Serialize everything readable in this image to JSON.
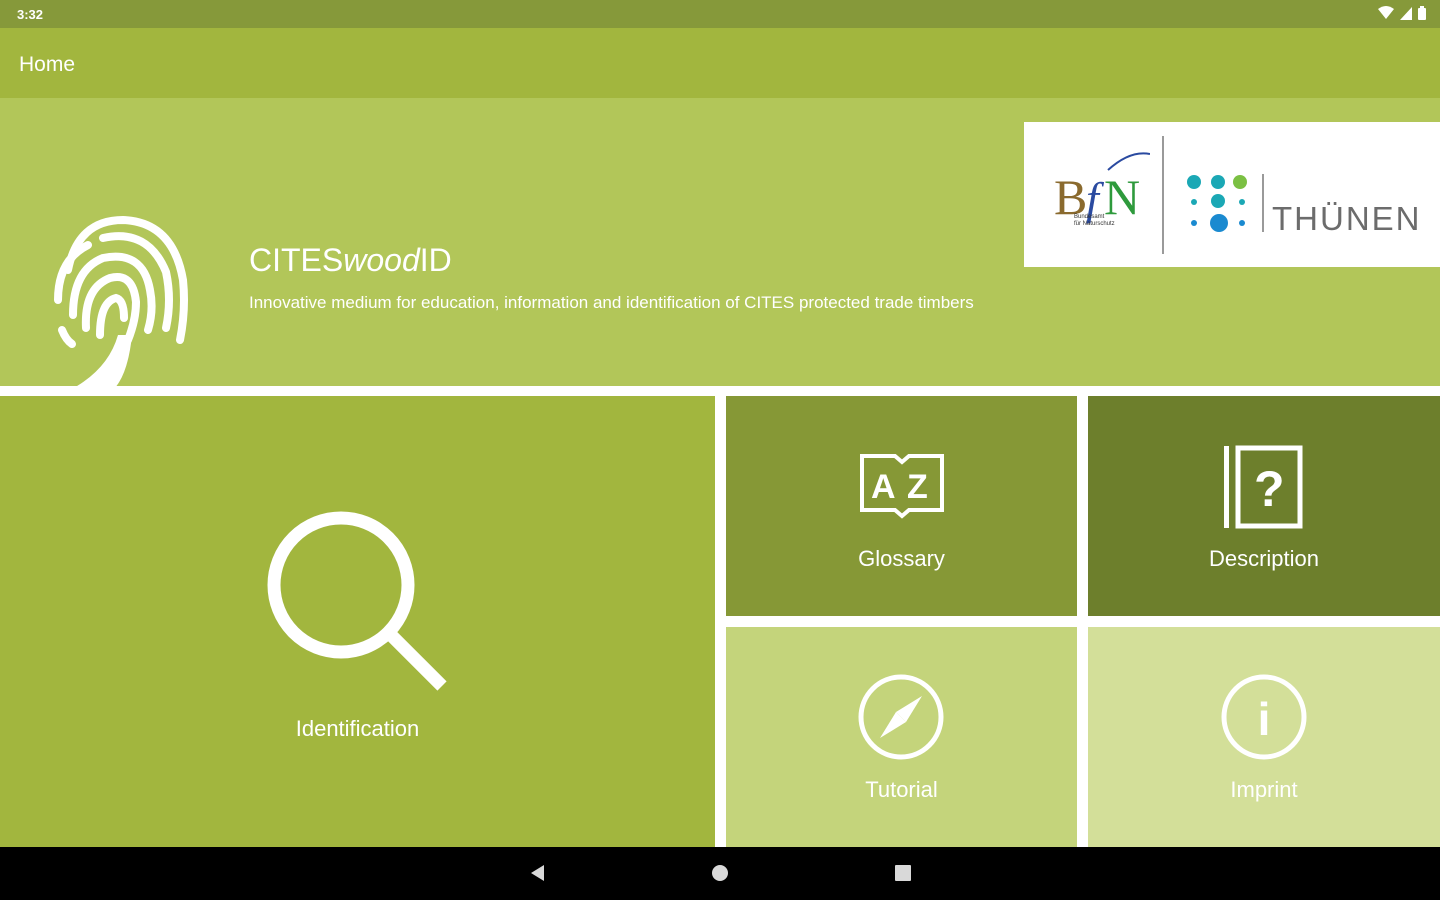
{
  "status_bar": {
    "time": "3:32"
  },
  "app_bar": {
    "title": "Home"
  },
  "header": {
    "app_name_prefix": "CITES",
    "app_name_italic": "wood",
    "app_name_suffix": "ID",
    "description": "Innovative medium for education, information and identification of CITES protected trade timbers"
  },
  "logos": {
    "bfn_letters": "BfN",
    "bfn_small_line1": "Bundesamt",
    "bfn_small_line2": "für Naturschutz",
    "thuenen_text": "THÜNEN"
  },
  "tiles": {
    "identification": {
      "label": "Identification",
      "icon": "search-icon"
    },
    "glossary": {
      "label": "Glossary",
      "icon": "az-book-icon",
      "icon_text_a": "A",
      "icon_text_z": "Z"
    },
    "description": {
      "label": "Description",
      "icon": "question-book-icon",
      "icon_text": "?"
    },
    "tutorial": {
      "label": "Tutorial",
      "icon": "compass-icon"
    },
    "imprint": {
      "label": "Imprint",
      "icon": "info-icon",
      "icon_text": "i"
    }
  },
  "colors": {
    "status_bar": "#86993a",
    "app_bar": "#a2b63e",
    "header": "#b2c659",
    "identification": "#a2b63e",
    "glossary": "#869836",
    "description": "#6d7f2c",
    "tutorial": "#c4d47b",
    "imprint": "#d3df99"
  }
}
